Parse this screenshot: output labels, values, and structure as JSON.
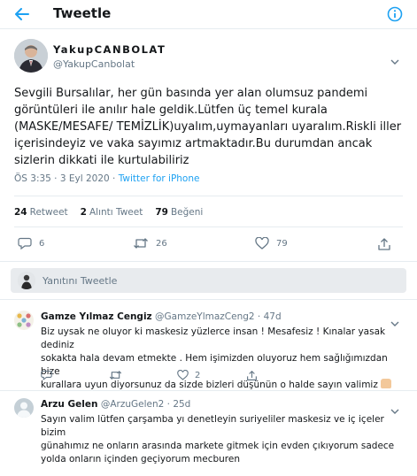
{
  "header": {
    "title": "Tweetle",
    "back_icon": "arrow-left-icon",
    "info_icon": "info-icon"
  },
  "author": {
    "name": "YakupCANBOLAT",
    "handle": "@YakupCanbolat"
  },
  "tweet": {
    "lines": [
      "Sevgili Bursalılar, her gün basında yer alan olumsuz pandemi",
      "görüntüleri ile  anılır hale geldik.Lütfen üç temel kurala",
      "(MASKE/MESAFE/ TEMİZLİK)uyalım,uymayanları uyaralım.Riskli iller",
      "içerisindeyiz ve vaka sayımız artmaktadır.Bu durumdan ancak",
      "sizlerin dikkati ile kurtulabiliriz"
    ],
    "time": "ÖS 3:35 · 3 Eyl 2020 · ",
    "source": "Twitter for iPhone"
  },
  "stats": {
    "retweet_count": "24",
    "retweet_label": "Retweet",
    "quote_count": "2",
    "quote_label": "Alıntı Tweet",
    "like_count": "79",
    "like_label": "Beğeni"
  },
  "actions": {
    "reply_count": "6",
    "retweet_count": "26",
    "like_count": "79"
  },
  "reply_box": {
    "label": "Yanıtını Tweetle"
  },
  "replies": [
    {
      "name": "Gamze Yılmaz Cengiz",
      "handle": "@GamzeYlmazCeng2 · 47d",
      "lines": [
        "Biz uysak ne oluyor ki maskesiz yüzlerce insan ! Mesafesiz ! Kınalar yasak dediniz",
        "sokakta hala devam etmekte . Hem işimizden oluyoruz hem sağlığımızdan bize",
        "kurallara uyun diyorsunuz da sizde bizleri düşünün o halde sayın valimiz"
      ],
      "reply_count": "",
      "retweet_count": "",
      "like_count": "2"
    },
    {
      "name": "Arzu Gelen",
      "handle": "@ArzuGelen2 · 25d",
      "lines": [
        "Sayın valim lütfen çarşamba yı denetleyin suriyeliler maskesiz ve iç içeler bizim",
        "günahımız ne onların arasında markete gitmek için evden çıkıyorum sadece",
        "yolda onların içinden geçiyorum mecburen"
      ],
      "reply_count": "",
      "retweet_count": "",
      "like_count": ""
    }
  ],
  "colors": {
    "accent": "#1da1f2",
    "secondary_text": "#657786",
    "divider": "#e6ecf0",
    "reply_bar": "#e8ebee"
  }
}
